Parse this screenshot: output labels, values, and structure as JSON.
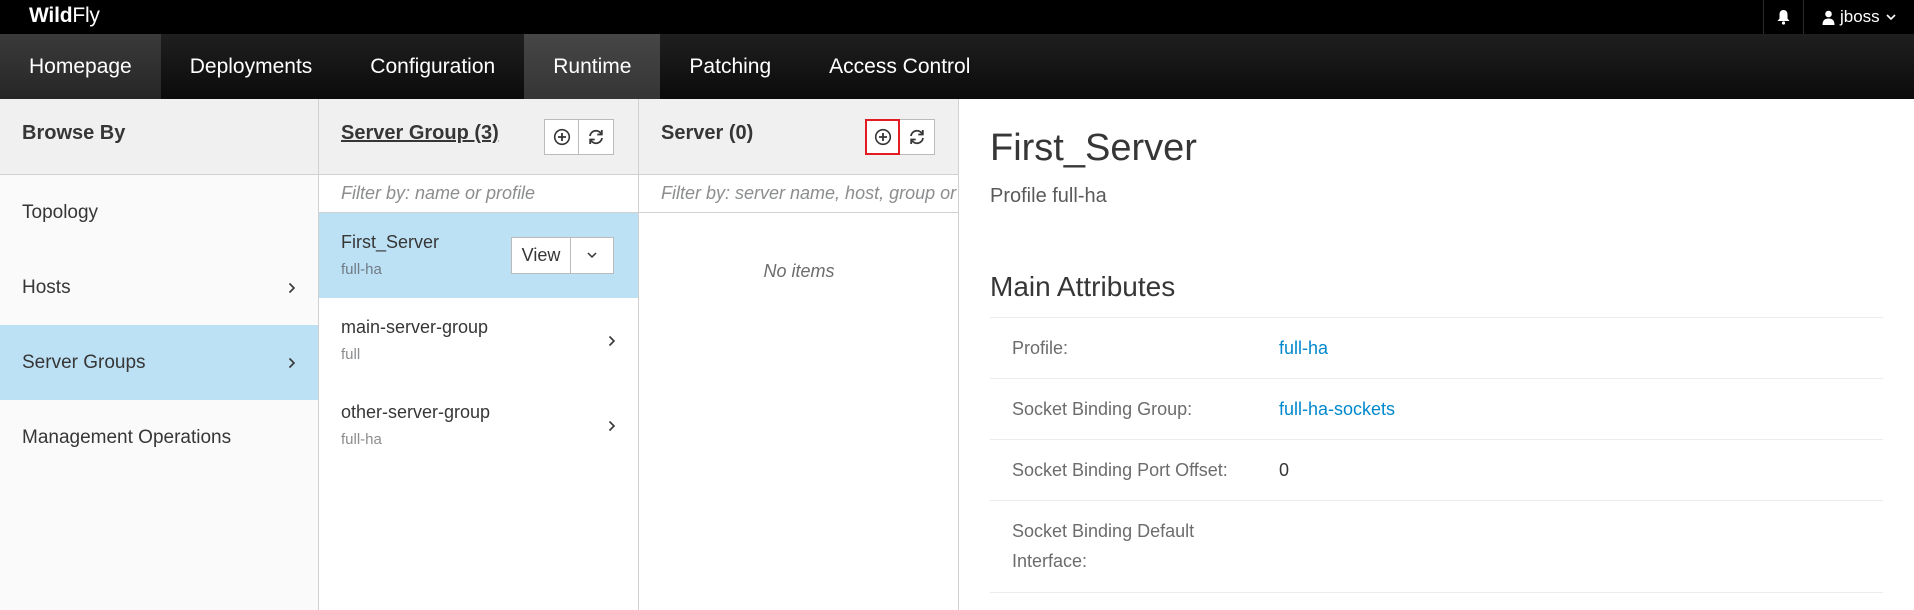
{
  "topbar": {
    "brand_bold": "Wild",
    "brand_rest": "Fly",
    "user": "jboss"
  },
  "nav": [
    "Homepage",
    "Deployments",
    "Configuration",
    "Runtime",
    "Patching",
    "Access Control"
  ],
  "browse": {
    "title": "Browse By",
    "items": [
      "Topology",
      "Hosts",
      "Server Groups",
      "Management Operations"
    ]
  },
  "server_groups": {
    "title": "Server Group (3)",
    "filter_placeholder": "Filter by: name or profile",
    "view_label": "View",
    "items": [
      {
        "name": "First_Server",
        "profile": "full-ha"
      },
      {
        "name": "main-server-group",
        "profile": "full"
      },
      {
        "name": "other-server-group",
        "profile": "full-ha"
      }
    ]
  },
  "servers": {
    "title": "Server (0)",
    "filter_placeholder": "Filter by: server name, host, group or status",
    "empty": "No items"
  },
  "detail": {
    "title": "First_Server",
    "subtitle": "Profile full-ha",
    "section": "Main Attributes",
    "attrs": [
      {
        "label": "Profile:",
        "value": "full-ha"
      },
      {
        "label": "Socket Binding Group:",
        "value": "full-ha-sockets"
      },
      {
        "label": "Socket Binding Port Offset:",
        "value": "0"
      },
      {
        "label": "Socket Binding Default Interface:",
        "value": ""
      }
    ]
  },
  "colors": {
    "selected": "#bde1f4",
    "link": "#0088ce",
    "highlight": "#e31b23"
  }
}
